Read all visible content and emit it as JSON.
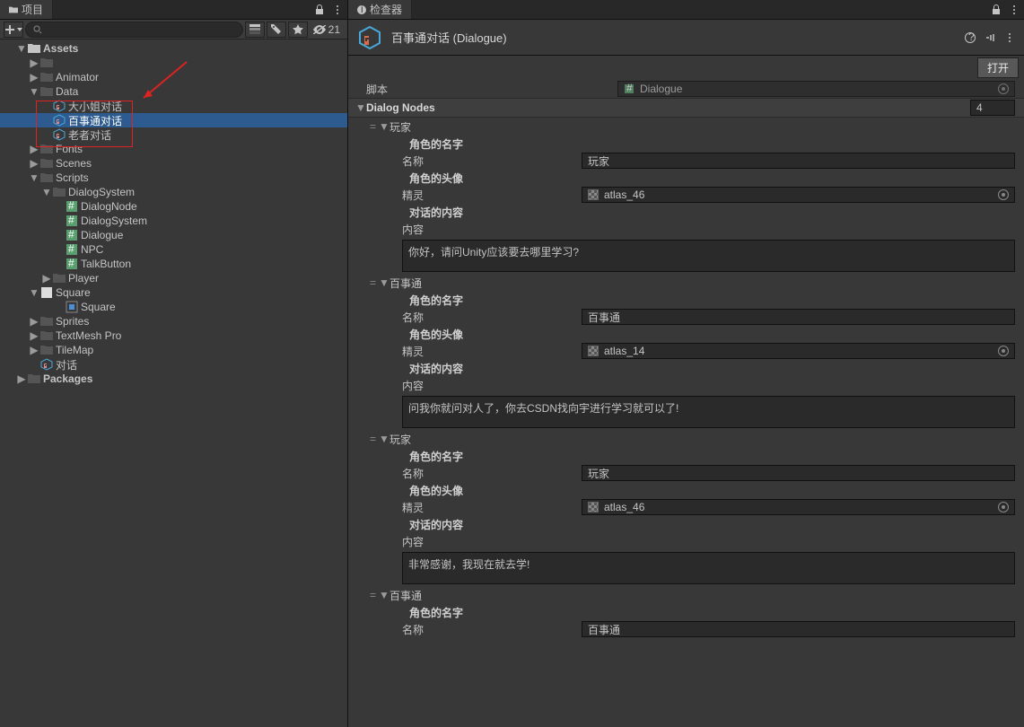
{
  "project": {
    "tab_title": "项目",
    "hidden_count": "21",
    "search_placeholder": "",
    "tree": {
      "assets": "Assets",
      "animator": "Animator",
      "data": "Data",
      "data_items": [
        "大小姐对话",
        "百事通对话",
        "老者对话"
      ],
      "fonts": "Fonts",
      "scenes": "Scenes",
      "scripts": "Scripts",
      "dialogsystem": "DialogSystem",
      "ds_items": [
        "DialogNode",
        "DialogSystem",
        "Dialogue",
        "NPC",
        "TalkButton"
      ],
      "player": "Player",
      "square": "Square",
      "square_child": "Square",
      "sprites": "Sprites",
      "textmeshpro": "TextMesh Pro",
      "tilemap": "TileMap",
      "dialogue_asset": "对话",
      "packages": "Packages"
    }
  },
  "inspector": {
    "tab_title": "检查器",
    "asset_name": "百事通对话 (Dialogue)",
    "open_btn": "打开",
    "script_label": "脚本",
    "script_value": "Dialogue",
    "dialog_nodes_label": "Dialog Nodes",
    "dialog_nodes_count": "4",
    "labels": {
      "role_name_hdr": "角色的名字",
      "name": "名称",
      "role_avatar_hdr": "角色的头像",
      "sprite": "精灵",
      "content_hdr": "对话的内容",
      "content": "内容"
    },
    "nodes": [
      {
        "title": "玩家",
        "name": "玩家",
        "sprite": "atlas_46",
        "content": "你好，请问Unity应该要去哪里学习?"
      },
      {
        "title": "百事通",
        "name": "百事通",
        "sprite": "atlas_14",
        "content": "问我你就问对人了，你去CSDN找向宇进行学习就可以了!"
      },
      {
        "title": "玩家",
        "name": "玩家",
        "sprite": "atlas_46",
        "content": "非常感谢，我现在就去学!"
      },
      {
        "title": "百事通",
        "name": "百事通",
        "sprite": "",
        "content": ""
      }
    ]
  }
}
